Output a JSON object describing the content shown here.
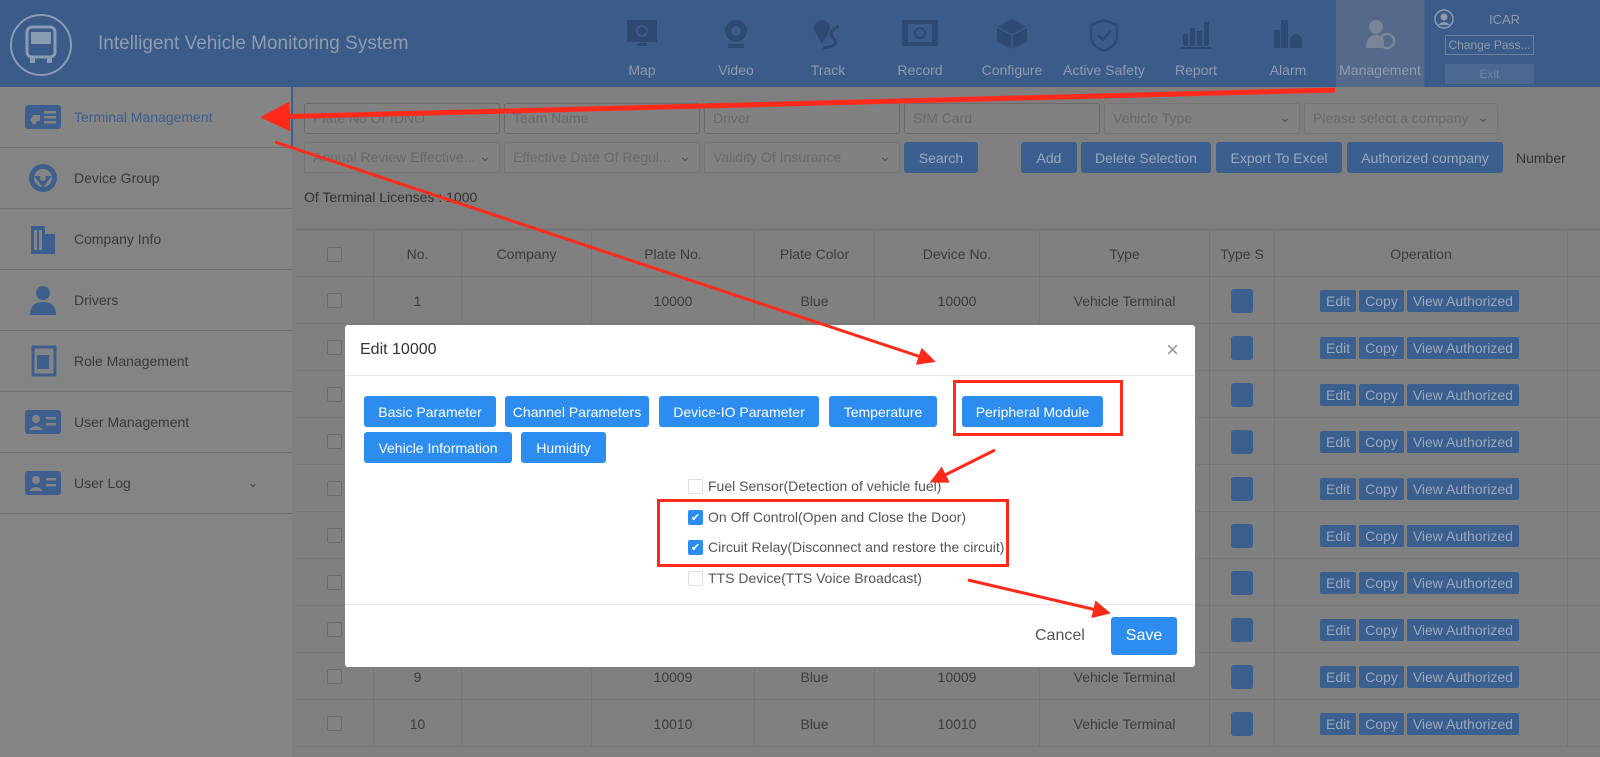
{
  "header": {
    "title": "Intelligent Vehicle Monitoring System",
    "nav": [
      {
        "label": "Map",
        "icon": "monitor-icon"
      },
      {
        "label": "Video",
        "icon": "webcam-icon"
      },
      {
        "label": "Track",
        "icon": "route-pin-icon"
      },
      {
        "label": "Record",
        "icon": "film-icon"
      },
      {
        "label": "Configure",
        "icon": "cube-icon"
      },
      {
        "label": "Active Safety",
        "icon": "shield-check-icon"
      },
      {
        "label": "Report",
        "icon": "bar-chart-icon"
      },
      {
        "label": "Alarm",
        "icon": "alarm-building-icon"
      },
      {
        "label": "Management",
        "icon": "user-gear-icon",
        "active": true
      }
    ],
    "user": {
      "name": "ICAR",
      "change_password": "Change Pass...",
      "exit": "Exit"
    }
  },
  "sidebar": {
    "items": [
      {
        "label": "Terminal Management",
        "icon": "truck-list-icon",
        "active": true
      },
      {
        "label": "Device Group",
        "icon": "steering-wheel-icon"
      },
      {
        "label": "Company Info",
        "icon": "building-icon"
      },
      {
        "label": "Drivers",
        "icon": "driver-icon"
      },
      {
        "label": "Role Management",
        "icon": "role-card-icon"
      },
      {
        "label": "User Management",
        "icon": "id-card-icon"
      },
      {
        "label": "User Log",
        "icon": "id-card-icon",
        "expandable": true
      }
    ]
  },
  "filters": {
    "plate": "Plate No Or IDNO",
    "team": "Team Name",
    "driver": "Driver",
    "sim": "SIM Card",
    "vehicle_type": "Vehicle Type",
    "company": "Please select a company",
    "annual_review": "Annual Review Effective...",
    "regulation": "Effective Date Of Regul...",
    "insurance": "Validity Of Insurance"
  },
  "toolbar": {
    "search": "Search",
    "add": "Add",
    "delete": "Delete Selection",
    "export": "Export To Excel",
    "authorized": "Authorized company",
    "number": "Number",
    "licenses": "Of Terminal Licenses : 1000"
  },
  "table": {
    "columns": [
      "No.",
      "Company",
      "Plate No.",
      "Plate Color",
      "Device No.",
      "Type",
      "Type S",
      "Operation"
    ],
    "ops": {
      "edit": "Edit",
      "copy": "Copy",
      "view": "View Authorized"
    },
    "rows": [
      {
        "no": "1",
        "plate": "10000",
        "color": "Blue",
        "device": "10000",
        "type": "Vehicle Terminal"
      },
      {
        "no": "",
        "plate": "",
        "color": "",
        "device": "",
        "type": ""
      },
      {
        "no": "",
        "plate": "",
        "color": "",
        "device": "",
        "type": ""
      },
      {
        "no": "",
        "plate": "",
        "color": "",
        "device": "",
        "type": ""
      },
      {
        "no": "",
        "plate": "",
        "color": "",
        "device": "",
        "type": ""
      },
      {
        "no": "",
        "plate": "",
        "color": "",
        "device": "",
        "type": ""
      },
      {
        "no": "",
        "plate": "",
        "color": "",
        "device": "",
        "type": ""
      },
      {
        "no": "",
        "plate": "",
        "color": "",
        "device": "",
        "type": ""
      },
      {
        "no": "9",
        "plate": "10009",
        "color": "Blue",
        "device": "10009",
        "type": "Vehicle Terminal"
      },
      {
        "no": "10",
        "plate": "10010",
        "color": "Blue",
        "device": "10010",
        "type": "Vehicle Terminal"
      }
    ]
  },
  "modal": {
    "title": "Edit 10000",
    "tabs": [
      "Basic Parameter",
      "Channel Parameters",
      "Device-IO Parameter",
      "Temperature",
      "Peripheral Module",
      "Vehicle Information",
      "Humidity"
    ],
    "options": [
      {
        "label": "Fuel Sensor(Detection of vehicle fuel)",
        "checked": false
      },
      {
        "label": "On Off Control(Open and Close the Door)",
        "checked": true
      },
      {
        "label": "Circuit Relay(Disconnect and restore the circuit)",
        "checked": true
      },
      {
        "label": "TTS Device(TTS Voice Broadcast)",
        "checked": false
      }
    ],
    "cancel": "Cancel",
    "save": "Save"
  },
  "colors": {
    "primary": "#2d8cf0",
    "annotation": "#ff2a1a",
    "header": "#3b5b88"
  }
}
